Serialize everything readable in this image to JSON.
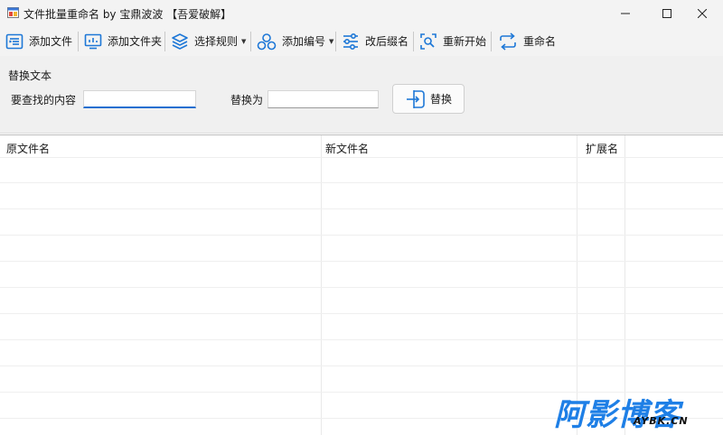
{
  "window": {
    "title": "文件批量重命名 by 宝鼎波波 【吾爱破解】"
  },
  "toolbar": {
    "add_file": "添加文件",
    "add_folder": "添加文件夹",
    "select_rule": "选择规则",
    "add_number": "添加编号",
    "change_ext": "改后缀名",
    "restart": "重新开始",
    "rename": "重命名"
  },
  "panel": {
    "group_title": "替换文本",
    "find_label": "要查找的内容",
    "find_value": "",
    "replace_label": "替换为",
    "replace_value": "",
    "replace_button": "替换"
  },
  "table": {
    "columns": [
      "原文件名",
      "新文件名",
      "扩展名"
    ],
    "rows": []
  },
  "watermark": {
    "main": "阿影博客",
    "sub": "AYBK.CN"
  },
  "colors": {
    "accent": "#1f6fd0",
    "icon_blue": "#1e78d7",
    "watermark_blue": "#1e7fe6"
  }
}
